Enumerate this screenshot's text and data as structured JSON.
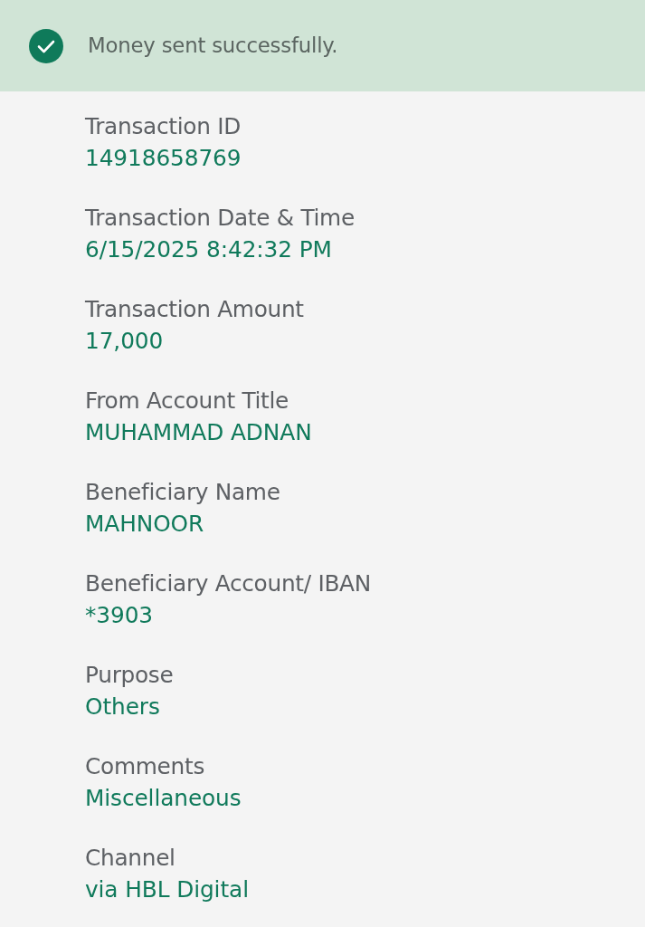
{
  "banner": {
    "kind": "success",
    "message": "Money sent successfully."
  },
  "details": [
    {
      "label": "Transaction ID",
      "value": "14918658769"
    },
    {
      "label": "Transaction Date & Time",
      "value": "6/15/2025 8:42:32 PM"
    },
    {
      "label": "Transaction Amount",
      "value": "17,000"
    },
    {
      "label": "From Account Title",
      "value": "MUHAMMAD ADNAN"
    },
    {
      "label": "Beneficiary Name",
      "value": "MAHNOOR"
    },
    {
      "label": "Beneficiary Account/ IBAN",
      "value": "*3903"
    },
    {
      "label": "Purpose",
      "value": "Others"
    },
    {
      "label": "Comments",
      "value": "Miscellaneous"
    },
    {
      "label": "Channel",
      "value": "via HBL Digital"
    }
  ]
}
